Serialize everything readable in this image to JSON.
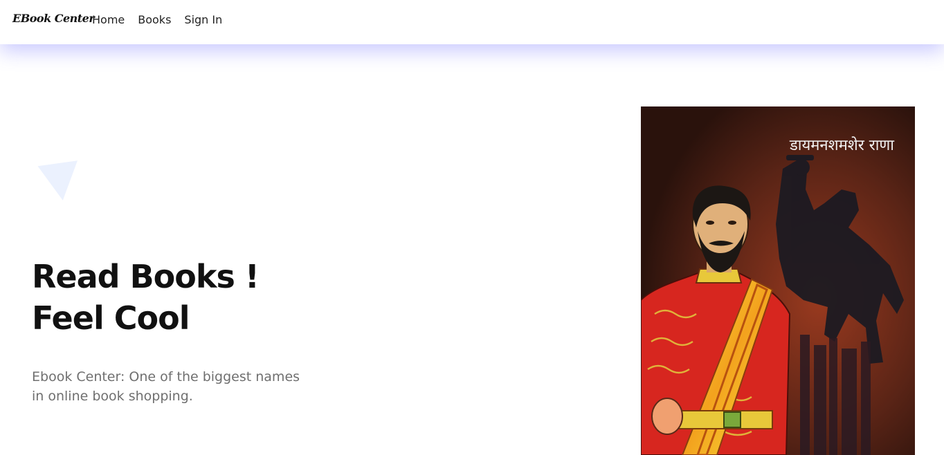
{
  "navbar": {
    "brand": "EBook Center",
    "links": [
      "Home",
      "Books",
      "Sign In"
    ]
  },
  "hero": {
    "title_line1": "Read Books !",
    "title_line2": "Feel Cool",
    "subtitle": "Ebook Center: One of the biggest names in online book shopping."
  },
  "book_cover": {
    "title": "डायमनशमशेर राणा"
  },
  "colors": {
    "nav_shadow": "#5a5aff",
    "triangle": "#ebf1fe",
    "subtitle": "#6f6f6f",
    "cover_bg": "#2a1510",
    "jacket_red": "#d7261f"
  }
}
